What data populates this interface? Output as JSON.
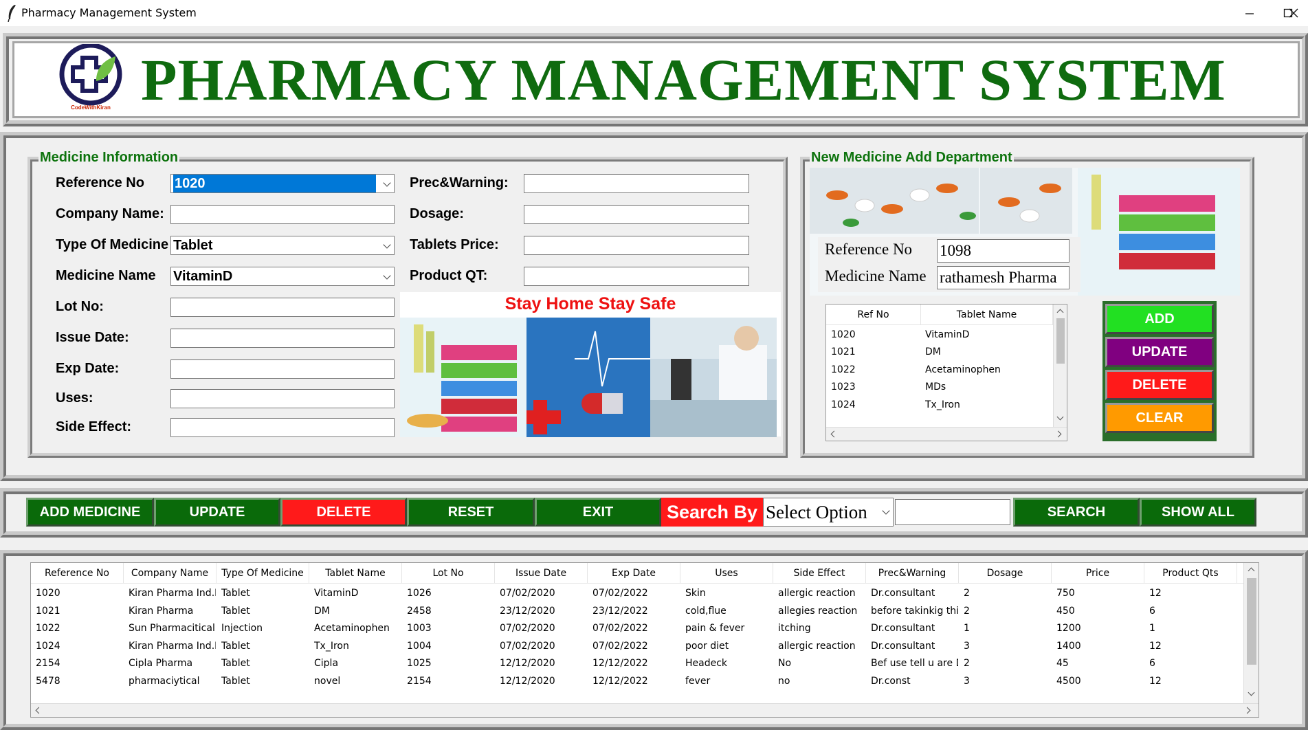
{
  "window": {
    "title": "Pharmacy Management System"
  },
  "header": {
    "title": "PHARMACY MANAGEMENT SYSTEM",
    "logo_caption": "CodeWithKiran"
  },
  "medicine_info": {
    "title": "Medicine Information",
    "labels": {
      "ref_no": "Reference No",
      "company": "Company Name:",
      "type": "Type Of Medicine",
      "med_name": "Medicine Name",
      "lot": "Lot No:",
      "issue": "Issue Date:",
      "exp": "Exp Date:",
      "uses": "Uses:",
      "side": "Side Effect:",
      "prec": "Prec&Warning:",
      "dosage": "Dosage:",
      "price": "Tablets Price:",
      "qty": "Product QT:"
    },
    "values": {
      "ref_no": "1020",
      "company": "",
      "type": "Tablet",
      "med_name": "VitaminD",
      "lot": "",
      "issue": "",
      "exp": "",
      "uses": "",
      "side": "",
      "prec": "",
      "dosage": "",
      "price": "",
      "qty": ""
    },
    "banner": "Stay Home Stay Safe"
  },
  "new_medicine": {
    "title": "New Medicine Add Department",
    "ref_label": "Reference No",
    "ref_value": "1098",
    "name_label": "Medicine Name",
    "name_value": "rathamesh Pharma",
    "table": {
      "headers": [
        "Ref No",
        "Tablet Name"
      ],
      "rows": [
        [
          "1020",
          "VitaminD"
        ],
        [
          "1021",
          "DM"
        ],
        [
          "1022",
          "Acetaminophen"
        ],
        [
          "1023",
          "MDs"
        ],
        [
          "1024",
          "Tx_Iron"
        ]
      ]
    },
    "buttons": {
      "add": "ADD",
      "update": "UPDATE",
      "delete": "DELETE",
      "clear": "CLEAR"
    }
  },
  "toolbar": {
    "add_medicine": "ADD MEDICINE",
    "update": "UPDATE",
    "delete": "DELETE",
    "reset": "RESET",
    "exit": "EXIT",
    "search_by": "Search By",
    "select_option": "Select Option",
    "search_text": "",
    "search": "SEARCH",
    "show_all": "SHOW ALL"
  },
  "records": {
    "headers": [
      "Reference No",
      "Company Name",
      "Type Of Medicine",
      "Tablet Name",
      "Lot No",
      "Issue Date",
      "Exp Date",
      "Uses",
      "Side Effect",
      "Prec&Warning",
      "Dosage",
      "Price",
      "Product Qts"
    ],
    "rows": [
      [
        "1020",
        "Kiran Pharma Ind.Lt",
        "Tablet",
        "VitaminD",
        "1026",
        "07/02/2020",
        "07/02/2022",
        "Skin",
        "allergic reaction",
        "Dr.consultant",
        "2",
        "750",
        "12"
      ],
      [
        "1021",
        "Kiran Pharma",
        "Tablet",
        "DM",
        "2458",
        "23/12/2020",
        "23/12/2022",
        "cold,flue",
        "allegies reaction",
        "before takinkig this",
        "2",
        "450",
        "6"
      ],
      [
        "1022",
        "Sun Pharmacitical I",
        "Injection",
        "Acetaminophen",
        "1003",
        "07/02/2020",
        "07/02/2022",
        "pain & fever",
        "itching",
        "Dr.consultant",
        "1",
        "1200",
        "1"
      ],
      [
        "1024",
        "Kiran Pharma Ind.Lt",
        "Tablet",
        "Tx_Iron",
        "1004",
        "07/02/2020",
        "07/02/2022",
        "poor diet",
        "allergic reaction",
        "Dr.consultant",
        "3",
        "1400",
        "12"
      ],
      [
        "2154",
        "Cipla Pharma",
        "Tablet",
        "Cipla",
        "1025",
        "12/12/2020",
        "12/12/2022",
        "Headeck",
        "No",
        "Bef use tell u are Dr",
        "2",
        "45",
        "6"
      ],
      [
        "5478",
        "pharmaciytical",
        "Tablet",
        "novel",
        "2154",
        "12/12/2020",
        "12/12/2022",
        "fever",
        "no",
        "Dr.const",
        "3",
        "4500",
        "12"
      ]
    ]
  },
  "colors": {
    "title_green": "#0f6b0f",
    "btn_green": "#006400",
    "btn_red": "#ff0000",
    "btn_purple": "#800080",
    "btn_orange": "#ff9900",
    "btn_lime": "#00e000"
  }
}
